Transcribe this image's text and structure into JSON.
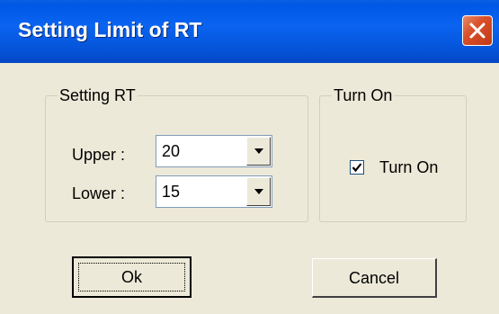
{
  "window": {
    "title": "Setting Limit of RT"
  },
  "setting_group": {
    "legend": "Setting RT",
    "upper": {
      "label": "Upper :",
      "value": "20"
    },
    "lower": {
      "label": "Lower :",
      "value": "15"
    }
  },
  "turnon_group": {
    "legend": "Turn On",
    "checkbox_label": "Turn On",
    "checked": true
  },
  "buttons": {
    "ok": "Ok",
    "cancel": "Cancel"
  },
  "icons": {
    "close": "close-icon",
    "dropdown": "chevron-down-icon",
    "check": "checkmark-icon"
  },
  "colors": {
    "titlebar": "#0058e6",
    "close_button": "#d9502a",
    "dialog_background": "#ece9d8"
  }
}
